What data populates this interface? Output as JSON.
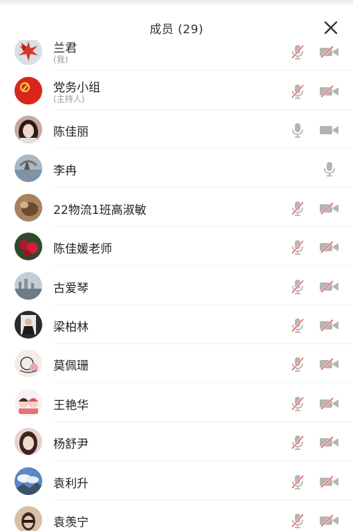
{
  "header": {
    "title": "成员 (29)"
  },
  "members": [
    {
      "name": "兰君",
      "sub": "(我)",
      "mic": "muted",
      "cam": "off",
      "avatar": "red-maple"
    },
    {
      "name": "党务小组",
      "sub": "(主持人)",
      "mic": "muted",
      "cam": "off",
      "avatar": "party-flag"
    },
    {
      "name": "陈佳丽",
      "sub": "",
      "mic": "on",
      "cam": "on",
      "avatar": "portrait-dark-hair"
    },
    {
      "name": "李冉",
      "sub": "",
      "mic": "on",
      "cam": "none",
      "avatar": "lake-tree"
    },
    {
      "name": "22物流1班高淑敏",
      "sub": "",
      "mic": "muted",
      "cam": "off",
      "avatar": "brown-animal"
    },
    {
      "name": "陈佳媛老师",
      "sub": "",
      "mic": "muted",
      "cam": "off",
      "avatar": "red-roses"
    },
    {
      "name": "古爱琴",
      "sub": "",
      "mic": "muted",
      "cam": "off",
      "avatar": "city-shore"
    },
    {
      "name": "梁柏林",
      "sub": "",
      "mic": "muted",
      "cam": "off",
      "avatar": "portrait-suit"
    },
    {
      "name": "莫佩珊",
      "sub": "",
      "mic": "muted",
      "cam": "off",
      "avatar": "cartoon-drawing"
    },
    {
      "name": "王艳华",
      "sub": "",
      "mic": "muted",
      "cam": "off",
      "avatar": "cartoon-couple"
    },
    {
      "name": "杨舒尹",
      "sub": "",
      "mic": "muted",
      "cam": "off",
      "avatar": "girl-portrait"
    },
    {
      "name": "袁利升",
      "sub": "",
      "mic": "muted",
      "cam": "off",
      "avatar": "clouds-mountain"
    },
    {
      "name": "袁羡宁",
      "sub": "",
      "mic": "muted",
      "cam": "off",
      "avatar": "sunglasses-portrait"
    }
  ],
  "colors": {
    "icon_gray": "#b4b4b4",
    "muted_slash": "#ec5a4f",
    "name_text": "#1f1f1f",
    "sub_text": "#9a9a9a"
  }
}
